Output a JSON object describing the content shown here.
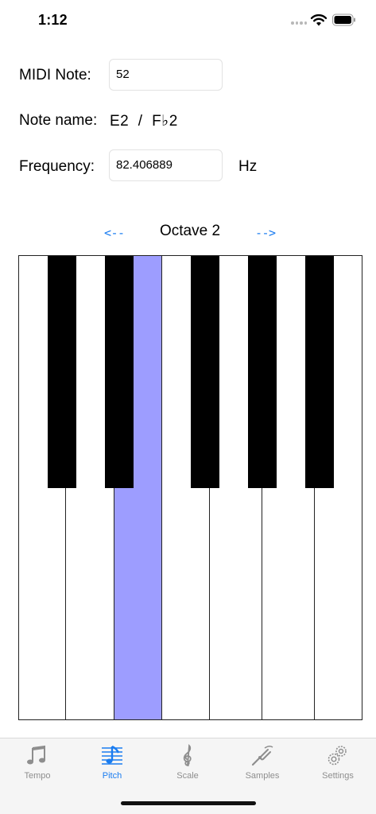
{
  "status_bar": {
    "time": "1:12"
  },
  "midi": {
    "label": "MIDI Note:",
    "value": "52"
  },
  "note_name": {
    "label": "Note name:",
    "value": "E2  /  F♭2"
  },
  "frequency": {
    "label": "Frequency:",
    "value": "82.406889",
    "unit": "Hz"
  },
  "octave": {
    "prev": "<--",
    "label": "Octave 2",
    "next": "-->"
  },
  "piano": {
    "white_keys": [
      "C",
      "D",
      "E",
      "F",
      "G",
      "A",
      "B"
    ],
    "active_key": "E",
    "active_color": "#9d9dff"
  },
  "tabs": [
    {
      "label": "Tempo",
      "icon": "music-notes-icon",
      "selected": false
    },
    {
      "label": "Pitch",
      "icon": "staff-notes-icon",
      "selected": true
    },
    {
      "label": "Scale",
      "icon": "treble-clef-icon",
      "selected": false
    },
    {
      "label": "Samples",
      "icon": "tuning-fork-icon",
      "selected": false
    },
    {
      "label": "Settings",
      "icon": "gears-icon",
      "selected": false
    }
  ],
  "colors": {
    "accent": "#1a7cf0",
    "inactive_tab": "#8e8e8e"
  }
}
